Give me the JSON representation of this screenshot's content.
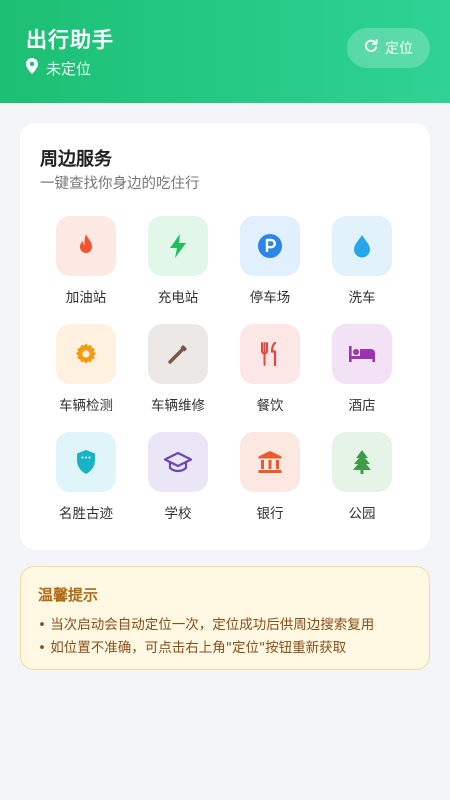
{
  "header": {
    "title": "出行助手",
    "location_text": "未定位",
    "locate_button": "定位",
    "colors": {
      "gradient_start": "#1cbf73",
      "gradient_end": "#2ed395"
    }
  },
  "services": {
    "title": "周边服务",
    "subtitle": "一键查找你身边的吃住行",
    "items": [
      {
        "label": "加油站",
        "icon": "fire-icon",
        "tile": "#fde9e4",
        "color": "#f4532f"
      },
      {
        "label": "充电站",
        "icon": "lightning-icon",
        "tile": "#e1f7ea",
        "color": "#1fbf5a"
      },
      {
        "label": "停车场",
        "icon": "parking-icon",
        "tile": "#e1efff",
        "color": "#2b86e8"
      },
      {
        "label": "洗车",
        "icon": "water-drop-icon",
        "tile": "#e1f2fb",
        "color": "#27a7e8"
      },
      {
        "label": "车辆检测",
        "icon": "gear-icon",
        "tile": "#fff1df",
        "color": "#f39c12"
      },
      {
        "label": "车辆维修",
        "icon": "wrench-icon",
        "tile": "#ece8e5",
        "color": "#795548"
      },
      {
        "label": "餐饮",
        "icon": "fork-knife-icon",
        "tile": "#fde7e6",
        "color": "#e2483d"
      },
      {
        "label": "酒店",
        "icon": "bed-icon",
        "tile": "#f3e2f5",
        "color": "#9c34b0"
      },
      {
        "label": "名胜古迹",
        "icon": "shield-icon",
        "tile": "#e0f5f9",
        "color": "#19b3c8"
      },
      {
        "label": "学校",
        "icon": "graduation-cap-icon",
        "tile": "#eae6f6",
        "color": "#6a48b4"
      },
      {
        "label": "银行",
        "icon": "bank-icon",
        "tile": "#fde8e1",
        "color": "#ea5a2c"
      },
      {
        "label": "公园",
        "icon": "tree-icon",
        "tile": "#e6f4e8",
        "color": "#3e9c47"
      }
    ]
  },
  "tips": {
    "title": "温馨提示",
    "lines": [
      "• 当次启动会自动定位一次，定位成功后供周边搜索复用",
      "• 如位置不准确，可点击右上角\"定位\"按钮重新获取"
    ]
  }
}
